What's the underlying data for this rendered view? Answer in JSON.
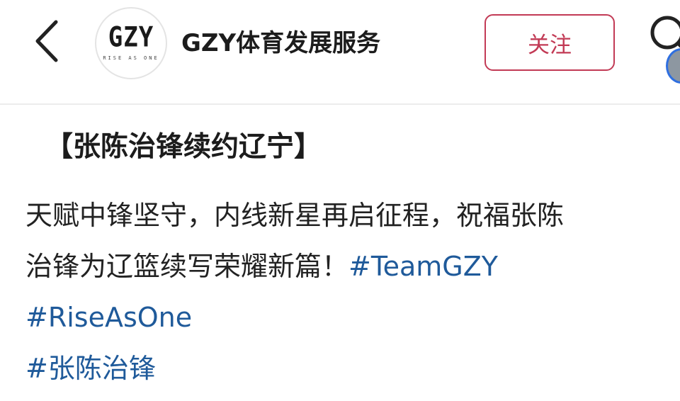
{
  "header": {
    "back_icon": "chevron-left-icon",
    "avatar_logo": "GZY",
    "avatar_tagline": "RISE AS ONE",
    "account_name": "GZY体育发展服务",
    "follow_label": "关注",
    "search_icon": "search-icon"
  },
  "post": {
    "title": "【张陈治锋续约辽宁】",
    "body_line1": "天赋中锋坚守，内线新星再启征程，祝福张陈",
    "body_line2": "治锋为辽篮续写荣耀新篇！",
    "hashtags": [
      "#TeamGZY",
      "#RiseAsOne",
      "#张陈治锋"
    ]
  },
  "colors": {
    "accent": "#c23a55",
    "hashtag": "#1f5a9a",
    "text": "#222222",
    "divider": "#ececec"
  }
}
